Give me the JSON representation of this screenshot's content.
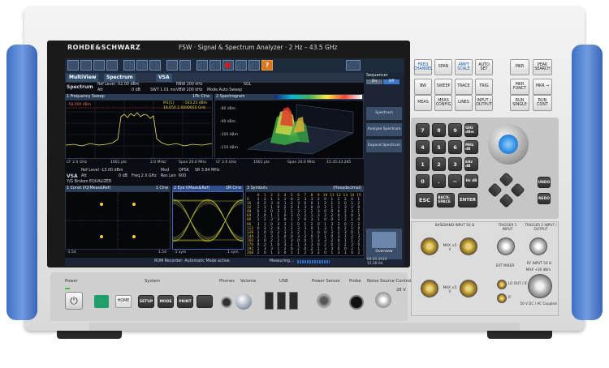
{
  "brand": "ROHDE&SCHWARZ",
  "model": "FSW · Signal & Spectrum Analyzer · 2 Hz – 43.5 GHz",
  "screen": {
    "tabs": [
      "MultiView",
      "Spectrum",
      "VSA"
    ],
    "sequencer": {
      "label": "Sequencer",
      "on": "On",
      "off": "Off"
    },
    "spectrum": {
      "name": "Spectrum",
      "ref_level": "Ref Level -52.00 dBm",
      "att": "Att",
      "att_val": "0 dB",
      "swt": "SWT 1.01 ms",
      "rbw": "RBW 200 kHz",
      "vbw": "VBW 200 kHz",
      "mode": "Mode Auto Sweep",
      "sgl": "SGL",
      "w1_title": "1 Frequency Sweep",
      "w1_trace": "1Pk Clrw",
      "w2_title": "2 Spectrogram",
      "marker": "M1[1]",
      "marker_val1": "-103.25 dBm",
      "marker_val2": "18.650 2.0000650 GHz",
      "ref_mark": "-58.000 dBm",
      "cf": "CF 2.0 GHz",
      "pts": "1001 pts",
      "span_div": "2.0 MHz/",
      "span": "Span 20.0 MHz",
      "cf2": "CF 2.0 GHz",
      "pts2": "1001 pts",
      "span2": "Span 20.0 MHz",
      "time": "15:35:33.285",
      "spec_y": [
        "-80 dBm",
        "-90 dBm",
        "-100 dBm",
        "-110 dBm"
      ]
    },
    "vsa": {
      "name": "VSA",
      "ref_level": "Ref Level -13.00 dBm",
      "att": "Att",
      "att_val": "0 dB",
      "freq": "Freq 2.0 GHz",
      "mod": "Mod",
      "mod_val": "QPSK",
      "sr": "SR 3.84 MHz",
      "res_len": "Res Len",
      "res_len_val": "600",
      "preset": "Y/G Broken EQUALIZER",
      "w1_title": "1 Const I/Q(Meas&Ref)",
      "w1_trace": "1 Clrw",
      "w2_title": "2 Eye I(Meas&Ref)",
      "w2_trace": "1M Clrw",
      "w3_title": "3 Symbols",
      "w3_format": "(Hexadecimal)",
      "const_l": "-1.54",
      "const_r": "1.54",
      "eye_l": "-1 sym",
      "eye_r": "1 sym",
      "sym_cols": [
        "0",
        "1",
        "2",
        "3",
        "4",
        "5",
        "6",
        "7",
        "8",
        "9",
        "10",
        "11",
        "12",
        "13",
        "14",
        "15"
      ],
      "sym_rows": [
        {
          "idx": "0",
          "vals": [
            "1",
            "2",
            "1",
            "3",
            "1",
            "0",
            "2",
            "3",
            "3",
            "2",
            "0",
            "1",
            "2",
            "2",
            "0",
            "1"
          ]
        },
        {
          "idx": "16",
          "vals": [
            "0",
            "2",
            "3",
            "0",
            "1",
            "3",
            "3",
            "0",
            "0",
            "1",
            "2",
            "1",
            "3",
            "0",
            "1",
            "2"
          ]
        },
        {
          "idx": "32",
          "vals": [
            "2",
            "3",
            "1",
            "0",
            "2",
            "2",
            "1",
            "3",
            "0",
            "0",
            "2",
            "1",
            "1",
            "3",
            "2",
            "0"
          ]
        },
        {
          "idx": "48",
          "vals": [
            "0",
            "3",
            "0",
            "2",
            "1",
            "1",
            "3",
            "2",
            "2",
            "3",
            "0",
            "0",
            "0",
            "2",
            "3",
            "1"
          ]
        },
        {
          "idx": "64",
          "vals": [
            "2",
            "0",
            "1",
            "1",
            "0",
            "3",
            "0",
            "2",
            "1",
            "3",
            "2",
            "2",
            "0",
            "1",
            "0",
            "3"
          ]
        },
        {
          "idx": "80",
          "vals": [
            "1",
            "2",
            "3",
            "2",
            "0",
            "1",
            "2",
            "0",
            "3",
            "1",
            "0",
            "0",
            "3",
            "2",
            "1",
            "0"
          ]
        },
        {
          "idx": "96",
          "vals": [
            "3",
            "1",
            "0",
            "3",
            "3",
            "1",
            "0",
            "1",
            "2",
            "0",
            "1",
            "3",
            "2",
            "0",
            "2",
            "2"
          ]
        },
        {
          "idx": "112",
          "vals": [
            "0",
            "3",
            "2",
            "0",
            "1",
            "2",
            "3",
            "3",
            "0",
            "1",
            "3",
            "1",
            "0",
            "2",
            "1",
            "0"
          ]
        },
        {
          "idx": "128",
          "vals": [
            "1",
            "0",
            "0",
            "2",
            "3",
            "3",
            "2",
            "1",
            "1",
            "0",
            "0",
            "3",
            "2",
            "3",
            "0",
            "1"
          ]
        },
        {
          "idx": "144",
          "vals": [
            "2",
            "1",
            "3",
            "1",
            "0",
            "0",
            "3",
            "2",
            "0",
            "2",
            "1",
            "0",
            "3",
            "1",
            "2",
            "3"
          ]
        },
        {
          "idx": "160",
          "vals": [
            "3",
            "0",
            "2",
            "2",
            "1",
            "3",
            "0",
            "0",
            "1",
            "3",
            "3",
            "2",
            "0",
            "1",
            "1",
            "2"
          ]
        },
        {
          "idx": "176",
          "vals": [
            "0",
            "2",
            "1",
            "0",
            "3",
            "2",
            "1",
            "3",
            "3",
            "0",
            "2",
            "0",
            "1",
            "2",
            "3",
            "0"
          ]
        },
        {
          "idx": "192",
          "vals": [
            "1",
            "3",
            "3",
            "1",
            "2",
            "0",
            "2",
            "0",
            "2",
            "1",
            "3",
            "3",
            "0",
            "0",
            "2",
            "1"
          ]
        },
        {
          "idx": "208",
          "vals": [
            "2",
            "0",
            "1",
            "3",
            "0",
            "1",
            "1",
            "2",
            "3",
            "2",
            "0",
            "1",
            "3",
            "1",
            "0",
            "2"
          ]
        }
      ]
    },
    "sidebar_buttons": [
      "Spectrum Reference",
      "Analyze Spectrum",
      "Expand Spectrum",
      "Overview"
    ],
    "status": {
      "recorder": "ROM Recorder: Automatic Mode active",
      "measuring": "Measuring...",
      "date": "04.01.2016",
      "time": "15:36:04"
    }
  },
  "front_panel": {
    "function_keys": [
      [
        "FREQ CHANNEL",
        "SPAN",
        "AMPT SCALE",
        "AUTO SET"
      ],
      [
        "BW",
        "SWEEP",
        "TRACE",
        "TRIG"
      ],
      [
        "MEAS",
        "MEAS CONFIG",
        "LINES",
        "INPUT / OUTPUT"
      ]
    ],
    "marker_keys": [
      "MKR",
      "PEAK SEARCH",
      "MKR FUNCT",
      "MKR →",
      "RUN SINGLE",
      "RUN CONT"
    ],
    "numpad": [
      [
        "7",
        "8",
        "9",
        "GHz dBm"
      ],
      [
        "4",
        "5",
        "6",
        "MHz dB"
      ],
      [
        "1",
        "2",
        "3",
        "kHz dB"
      ],
      [
        "0",
        ".",
        "−",
        "Hz dB"
      ]
    ],
    "control_keys": [
      "ESC",
      "BACK-SPACE",
      "ENTER"
    ],
    "undo": "UNDO",
    "redo": "REDO",
    "connectors": {
      "baseband": "BASEBAND INPUT 50 Ω",
      "trigger1": "TRIGGER 1 INPUT",
      "trigger2": "TRIGGER 2 INPUT / OUTPUT",
      "max_top": "MAX ±5 V",
      "ext_mixer": "EXT MIXER",
      "rf_input": "RF INPUT 50 Ω",
      "rf_max": "MAX +30 dBm",
      "rf_dc": "50 V DC / AC Coupled",
      "max_bottom": "MAX ±5 V",
      "lo": "LO OUT / IF IN",
      "if": "IF"
    },
    "front_labels": {
      "power": "Power",
      "system": "System",
      "phones": "Phones",
      "volume": "Volume",
      "usb": "USB",
      "power_sensor": "Power Sensor",
      "probe": "Probe",
      "noise": "Noise Source Control",
      "v28": "28 V"
    },
    "system_keys": [
      "HOME",
      "SETUP",
      "MODE",
      "PRINT"
    ]
  }
}
